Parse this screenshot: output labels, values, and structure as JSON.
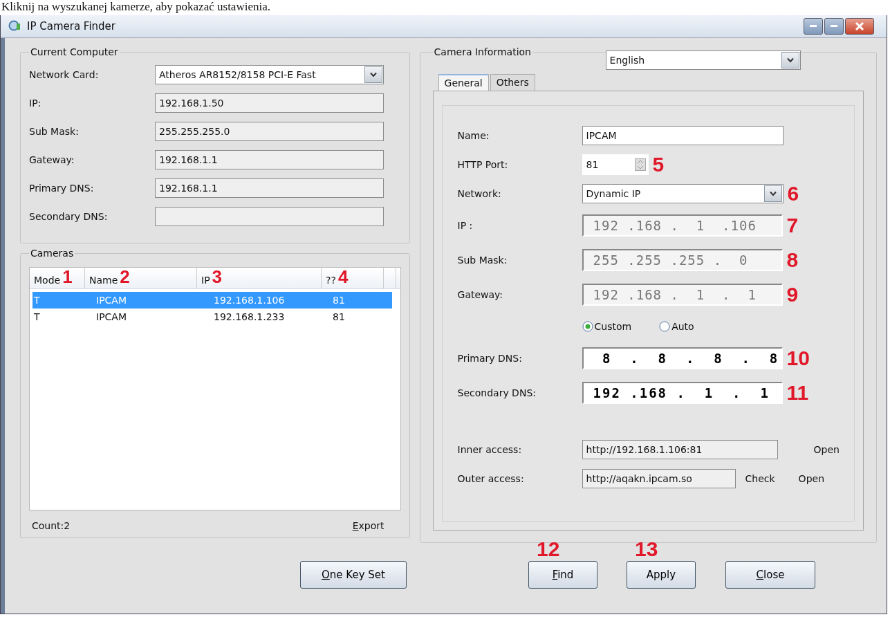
{
  "caption": "Kliknij na wyszukanej kamerze, aby pokazać ustawienia.",
  "window": {
    "title": "IP Camera Finder"
  },
  "current_computer": {
    "title": "Current Computer",
    "fields": [
      {
        "kind": "select",
        "label": "Network Card:",
        "value": "Atheros AR8152/8158 PCI-E Fast"
      },
      {
        "kind": "text",
        "label": "IP:",
        "value": "192.168.1.50"
      },
      {
        "kind": "text",
        "label": "Sub Mask:",
        "value": "255.255.255.0"
      },
      {
        "kind": "text",
        "label": "Gateway:",
        "value": "192.168.1.1"
      },
      {
        "kind": "text",
        "label": "Primary DNS:",
        "value": "192.168.1.1"
      },
      {
        "kind": "text",
        "label": "Secondary DNS:"
      }
    ]
  },
  "cameras": {
    "title": "Cameras",
    "columns": [
      {
        "label": "Mode",
        "marker": "1"
      },
      {
        "label": "Name",
        "marker": "2"
      },
      {
        "label": "IP",
        "marker": "3"
      },
      {
        "label": "??",
        "marker": "4"
      }
    ],
    "rows": [
      {
        "cells": [
          "T",
          "IPCAM",
          "192.168.1.106",
          "81"
        ],
        "selected": true
      },
      {
        "cells": [
          "T",
          "IPCAM",
          "192.168.1.233",
          "81"
        ],
        "selected": false
      }
    ],
    "count": "Count:2",
    "export": {
      "label": "Export",
      "underline_first": true
    }
  },
  "camera_info": {
    "title": "Camera Information",
    "language": "English",
    "tabs": [
      {
        "label": "General",
        "selected": true
      },
      {
        "label": "Others",
        "selected": false
      }
    ],
    "fields": [
      {
        "kind": "text",
        "label": "Name:",
        "value": "IPCAM"
      },
      {
        "kind": "spin",
        "label": "HTTP Port:",
        "value": "81",
        "marker": "5"
      },
      {
        "kind": "select",
        "label": "Network:",
        "value": "Dynamic IP",
        "marker": "6"
      },
      {
        "kind": "ip",
        "label": "IP :",
        "value": "192 .168 .  1  .106",
        "disabled": true,
        "marker": "7"
      },
      {
        "kind": "ip",
        "label": "Sub Mask:",
        "value": "255 .255 .255 .  0",
        "disabled": true,
        "marker": "8"
      },
      {
        "kind": "ip",
        "label": "Gateway:",
        "value": "192 .168 .  1  .  1",
        "disabled": true,
        "marker": "9"
      }
    ],
    "dns_mode": [
      {
        "label": "Custom",
        "selected": true
      },
      {
        "label": "Auto",
        "selected": false
      }
    ],
    "dns": [
      {
        "kind": "ip",
        "label": "Primary DNS:",
        "value": " 8  .  8  .  8  .  8",
        "disabled": false,
        "marker": "10"
      },
      {
        "kind": "ip",
        "label": "Secondary DNS:",
        "value": "192 .168 .  1  .  1",
        "disabled": false,
        "marker": "11"
      }
    ],
    "access": [
      {
        "label": "Inner access:",
        "value": "http://192.168.1.106:81",
        "actions": [
          "Open"
        ]
      },
      {
        "label": "Outer access:",
        "value": "http://aqakn.ipcam.so",
        "actions": [
          "Check",
          "Open"
        ]
      }
    ]
  },
  "buttons": [
    {
      "label": "One Key Set",
      "underline_first": true
    },
    {
      "label": "Find",
      "underline_first": true,
      "marker": "12"
    },
    {
      "label": "Apply",
      "underline_first": false,
      "marker": "13"
    },
    {
      "label": "Close",
      "underline_first": true
    }
  ]
}
